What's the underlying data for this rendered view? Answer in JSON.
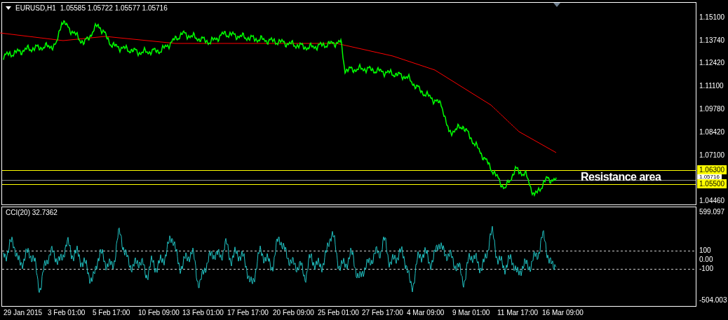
{
  "header": {
    "symbol": "EURUSD,H1",
    "ohlc": "1.05585 1.05722 1.05577 1.05716"
  },
  "price_axis": {
    "ticks": [
      "1.15100",
      "1.13740",
      "1.12420",
      "1.11100",
      "1.09780",
      "1.08420",
      "1.07100",
      "1.04460"
    ],
    "levels": [
      {
        "label": "1.06300",
        "kind": "level"
      },
      {
        "label": "1.05716",
        "kind": "current"
      },
      {
        "label": "1.05500",
        "kind": "level"
      }
    ]
  },
  "annotation": "Resistance area",
  "indicator": {
    "title": "CCI(20) 32.7362",
    "ticks": [
      "599.097",
      "100",
      "0.00",
      "-100",
      "-504.003"
    ]
  },
  "time_axis": [
    "29 Jan 2015",
    "3 Feb 01:00",
    "5 Feb 17:00",
    "10 Feb 09:00",
    "13 Feb 01:00",
    "17 Feb 17:00",
    "20 Feb 09:00",
    "25 Feb 01:00",
    "27 Feb 17:00",
    "4 Mar 09:00",
    "9 Mar 01:00",
    "11 Mar 17:00",
    "16 Mar 09:00"
  ]
}
